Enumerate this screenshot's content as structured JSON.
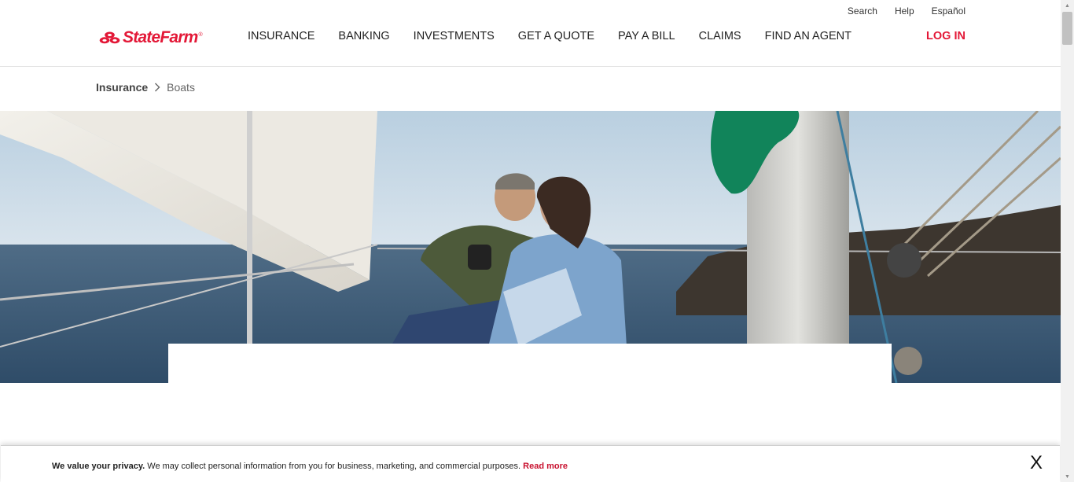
{
  "utility_nav": {
    "search": "Search",
    "help": "Help",
    "espanol": "Español"
  },
  "brand": {
    "logo_text": "StateFarm",
    "logo_reg": "®",
    "brand_color": "#e31837"
  },
  "main_nav": [
    "INSURANCE",
    "BANKING",
    "INVESTMENTS",
    "GET A QUOTE",
    "PAY A BILL",
    "CLAIMS",
    "FIND AN AGENT"
  ],
  "login": "LOG IN",
  "breadcrumb": {
    "home": "Insurance",
    "current": "Boats"
  },
  "privacy": {
    "lead": "We value your privacy.",
    "body": " We may collect personal information from you for business, marketing, and commercial purposes. ",
    "link": "Read more",
    "close": "X"
  },
  "icons": {
    "breadcrumb_separator": "chevron-right-icon",
    "logo_mark": "three-ovals-logo-icon"
  }
}
